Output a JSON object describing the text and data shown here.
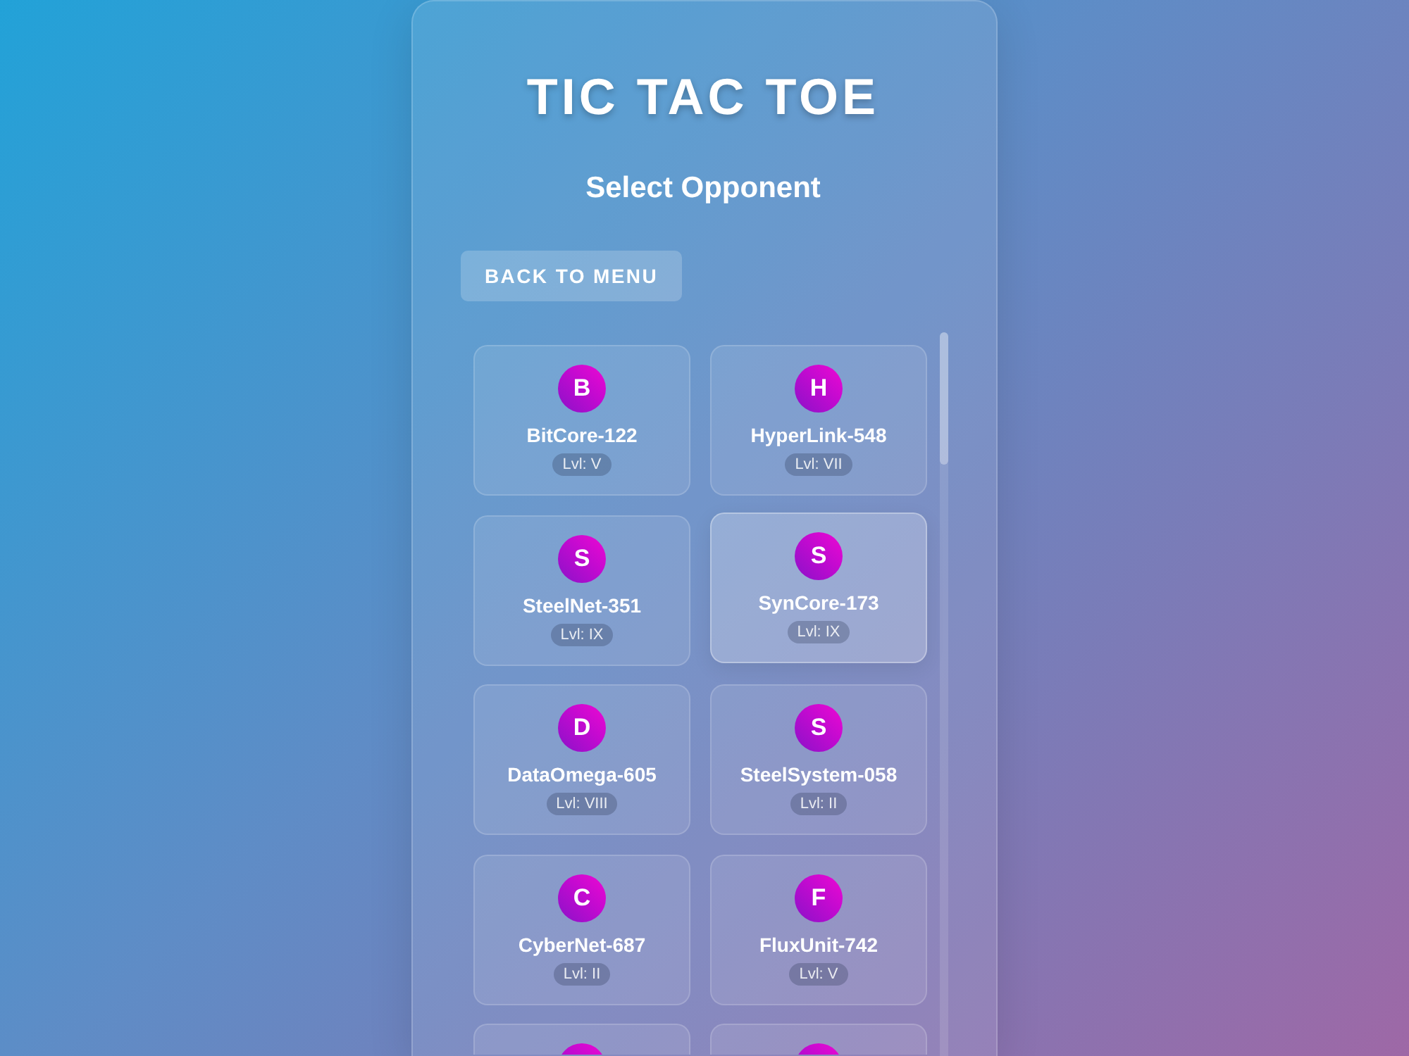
{
  "title": "TIC TAC TOE",
  "subtitle": "Select Opponent",
  "back_button": {
    "label": "BACK TO MENU"
  },
  "opponents": [
    {
      "initial": "B",
      "name": "BitCore-122",
      "badge": "Lvl: V",
      "selected": false
    },
    {
      "initial": "H",
      "name": "HyperLink-548",
      "badge": "Lvl: VII",
      "selected": false
    },
    {
      "initial": "S",
      "name": "SteelNet-351",
      "badge": "Lvl: IX",
      "selected": false
    },
    {
      "initial": "S",
      "name": "SynCore-173",
      "badge": "Lvl: IX",
      "selected": true
    },
    {
      "initial": "D",
      "name": "DataOmega-605",
      "badge": "Lvl: VIII",
      "selected": false
    },
    {
      "initial": "S",
      "name": "SteelSystem-058",
      "badge": "Lvl: II",
      "selected": false
    },
    {
      "initial": "C",
      "name": "CyberNet-687",
      "badge": "Lvl: II",
      "selected": false
    },
    {
      "initial": "F",
      "name": "FluxUnit-742",
      "badge": "Lvl: V",
      "selected": false
    },
    {
      "selected": false
    },
    {
      "selected": false
    }
  ]
}
